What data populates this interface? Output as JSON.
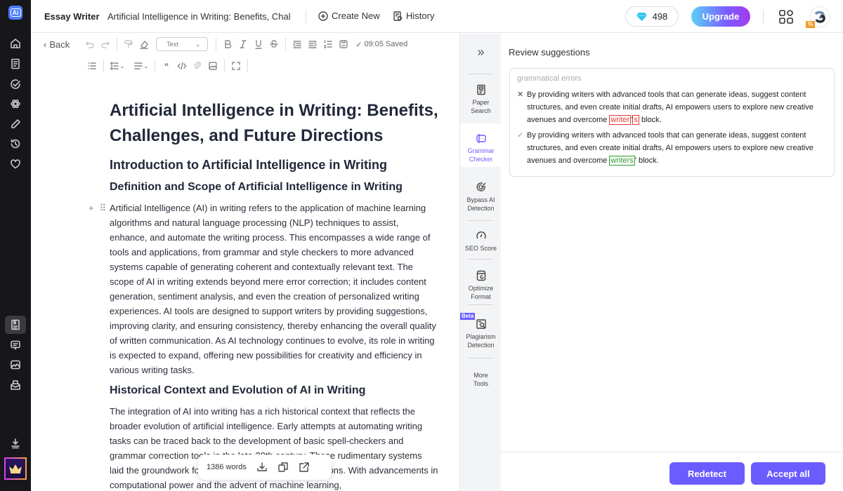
{
  "app": {
    "logo_text": "Ai",
    "name": "Essay Writer",
    "document_title": "Artificial Intelligence in Writing: Benefits, Chal"
  },
  "topbar": {
    "create_new": "Create New",
    "history": "History",
    "gems": "498",
    "upgrade": "Upgrade",
    "avatar_badge": "%"
  },
  "sidebar": {
    "icons": [
      "home-icon",
      "document-icon",
      "check-circle-icon",
      "atom-icon",
      "pencil-icon",
      "history-icon",
      "heart-icon",
      "essay-icon",
      "chat-icon",
      "image-icon",
      "inbox-icon",
      "download-icon",
      "crown-icon"
    ],
    "active": "essay-icon"
  },
  "toolbar": {
    "back": "Back",
    "text_style": "Text",
    "saved_time": "09:05 Saved"
  },
  "document": {
    "title": "Artificial Intelligence in Writing: Benefits, Challenges, and Future Directions",
    "h2_intro": "Introduction to Artificial Intelligence in Writing",
    "h3_definition": "Definition and Scope of Artificial Intelligence in Writing",
    "p1": "Artificial Intelligence (AI) in writing refers to the application of machine learning algorithms and natural language processing (NLP) techniques to assist, enhance, and automate the writing process. This encompasses a wide range of tools and applications, from grammar and style checkers to more advanced systems capable of generating coherent and contextually relevant text. The scope of AI in writing extends beyond mere error correction; it includes content generation, sentiment analysis, and even the creation of personalized writing experiences. AI tools are designed to support writers by providing suggestions, improving clarity, and ensuring consistency, thereby enhancing the overall quality of written communication. As AI technology continues to evolve, its role in writing is expected to expand, offering new possibilities for creativity and efficiency in various writing tasks.",
    "h3_history": "Historical Context and Evolution of AI in Writing",
    "p2": "The integration of AI into writing has a rich historical context that reflects the broader evolution of artificial intelligence. Early attempts at automating writing tasks can be traced back to the development of basic spell-checkers and grammar correction tools in the late 20th century. These rudimentary systems laid the groundwork for more sophisticated AI applications. With advancements in computational power and the advent of machine learning,"
  },
  "wordbar": {
    "count": "1386 words"
  },
  "tools": {
    "collapse": "»",
    "items": [
      {
        "label1": "Paper",
        "label2": "Search"
      },
      {
        "label1": "Grammar",
        "label2": "Checker"
      },
      {
        "label1": "Bypass AI",
        "label2": "Detection"
      },
      {
        "label1": "SEO Score",
        "label2": ""
      },
      {
        "label1": "Optimize",
        "label2": "Format"
      },
      {
        "label1": "Plagiarism",
        "label2": "Detection",
        "badge": "Beta"
      },
      {
        "label1": "More",
        "label2": "Tools"
      }
    ]
  },
  "panel": {
    "title": "Review suggestions",
    "category": "grammatical errors",
    "original": {
      "mark": "✕",
      "prefix": "By providing writers with advanced tools that can generate ideas, suggest content structures, and even create initial drafts, AI empowers users to explore new creative avenues and overcome ",
      "del1": "writer",
      "mid": "'",
      "del2": "s",
      "suffix": " block."
    },
    "suggested": {
      "mark": "✓",
      "prefix": "By providing writers with advanced tools that can generate ideas, suggest content structures, and even create initial drafts, AI empowers users to explore new creative avenues and overcome ",
      "ins": "writers",
      "suffix": "' block."
    },
    "redetect": "Redetect",
    "accept_all": "Accept all"
  }
}
